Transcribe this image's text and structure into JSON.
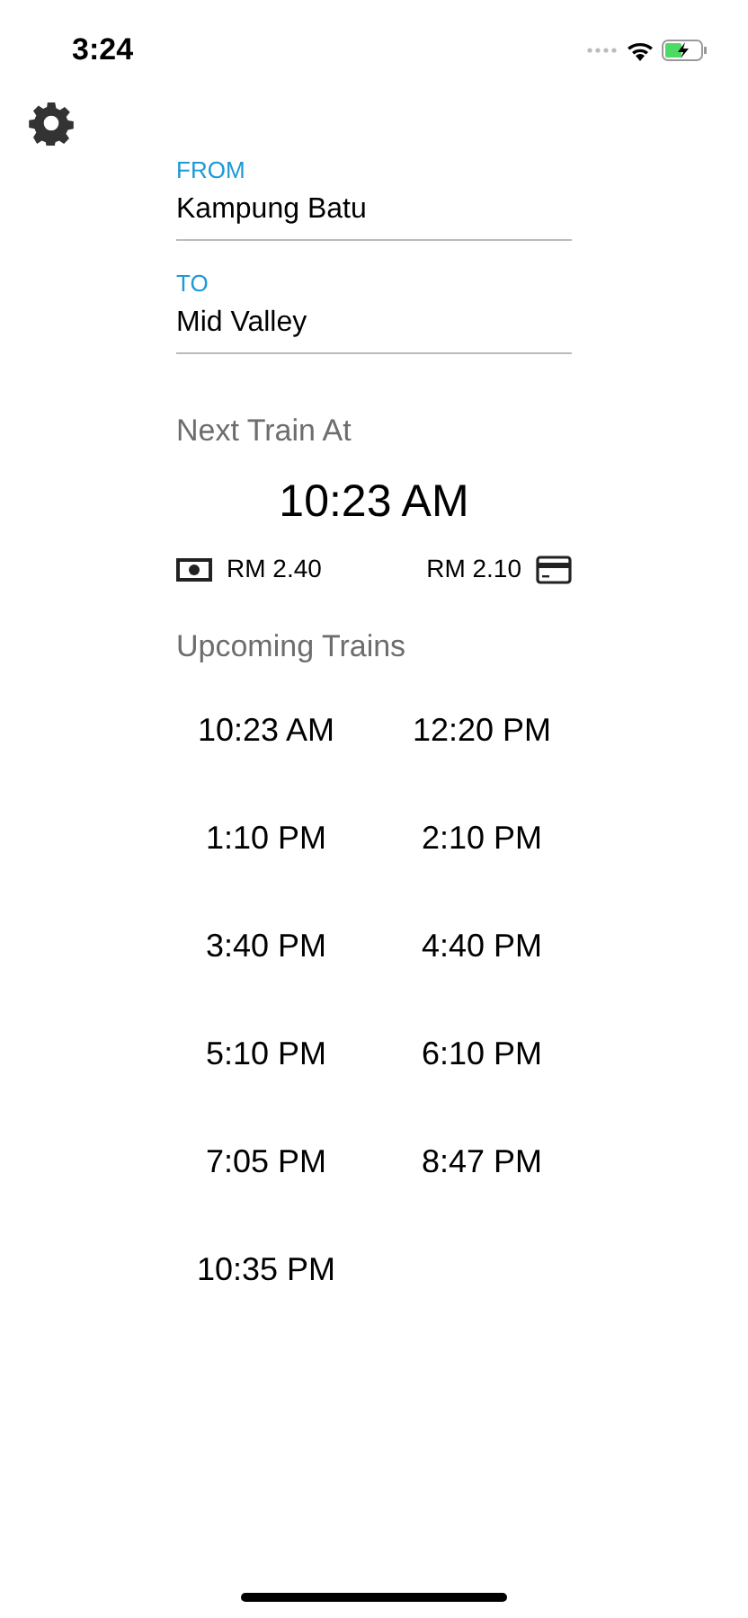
{
  "status_bar": {
    "time": "3:24"
  },
  "from": {
    "label": "FROM",
    "value": "Kampung Batu"
  },
  "to": {
    "label": "TO",
    "value": "Mid Valley"
  },
  "next_train": {
    "heading": "Next Train At",
    "time": "10:23 AM",
    "cash_fare": "RM 2.40",
    "card_fare": "RM 2.10"
  },
  "upcoming": {
    "heading": "Upcoming Trains",
    "times": [
      "10:23 AM",
      "12:20 PM",
      "1:10 PM",
      "2:10 PM",
      "3:40 PM",
      "4:40 PM",
      "5:10 PM",
      "6:10 PM",
      "7:05 PM",
      "8:47 PM",
      "10:35 PM"
    ]
  }
}
